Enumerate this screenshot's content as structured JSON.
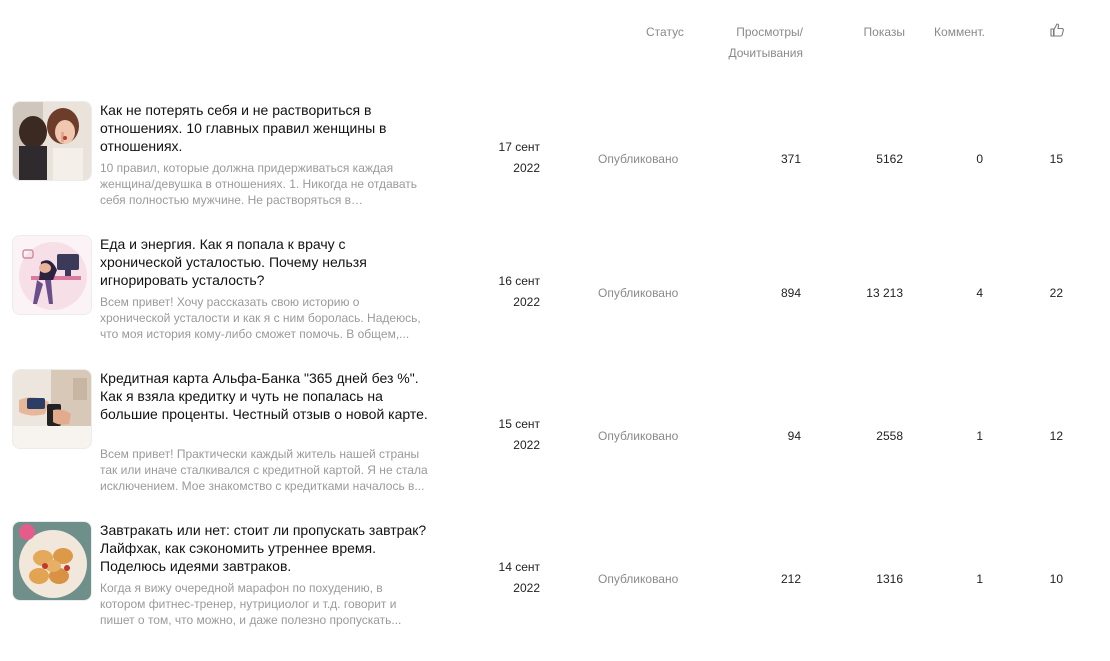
{
  "header": {
    "status": "Статус",
    "views_line1": "Просмотры/",
    "views_line2": "Дочитывания",
    "shows": "Показы",
    "comments": "Коммент.",
    "likes_icon": "thumbs-up-icon"
  },
  "articles": [
    {
      "title": "Как не потерять себя и не раствориться в отношениях. 10 главных правил женщины в отношениях.",
      "snippet": "10 правил, которые должна придерживаться каждая женщина/девушка в отношениях. 1. Никогда не отдавать себя полностью мужчине. Не растворяться в отношениях...",
      "date_day": "17 сент",
      "date_year": "2022",
      "status": "Опубликовано",
      "views": "371",
      "shows": "5162",
      "comments": "0",
      "likes": "15"
    },
    {
      "title": "Еда и энергия. Как я попала к врачу с хронической усталостью. Почему нельзя игнорировать усталость?",
      "snippet": "Всем привет! Хочу рассказать свою историю о хронической усталости и как я с ним боролась. Надеюсь, что моя история кому-либо сможет помочь. В общем,...",
      "date_day": "16 сент",
      "date_year": "2022",
      "status": "Опубликовано",
      "views": "894",
      "shows": "13 213",
      "comments": "4",
      "likes": "22"
    },
    {
      "title": "Кредитная карта Альфа-Банка \"365 дней без %\". Как я взяла кредитку и чуть не попалась на большие проценты. Честный отзыв о новой карте.",
      "snippet": "Всем привет! Практически каждый житель нашей страны так или иначе сталкивался с кредитной картой. Я не стала исключением. Мое знакомство с кредитками началось в...",
      "date_day": "15 сент",
      "date_year": "2022",
      "status": "Опубликовано",
      "views": "94",
      "shows": "2558",
      "comments": "1",
      "likes": "12"
    },
    {
      "title": "Завтракать или нет: стоит ли пропускать завтрак? Лайфхак, как сэкономить утреннее время. Поделюсь идеями завтраков.",
      "snippet": "Когда я вижу очередной марафон по похудению, в котором фитнес-тренер, нутрициолог и т.д. говорит и пишет о том, что можно, и даже полезно пропускать...",
      "date_day": "14 сент",
      "date_year": "2022",
      "status": "Опубликовано",
      "views": "212",
      "shows": "1316",
      "comments": "1",
      "likes": "10"
    }
  ]
}
